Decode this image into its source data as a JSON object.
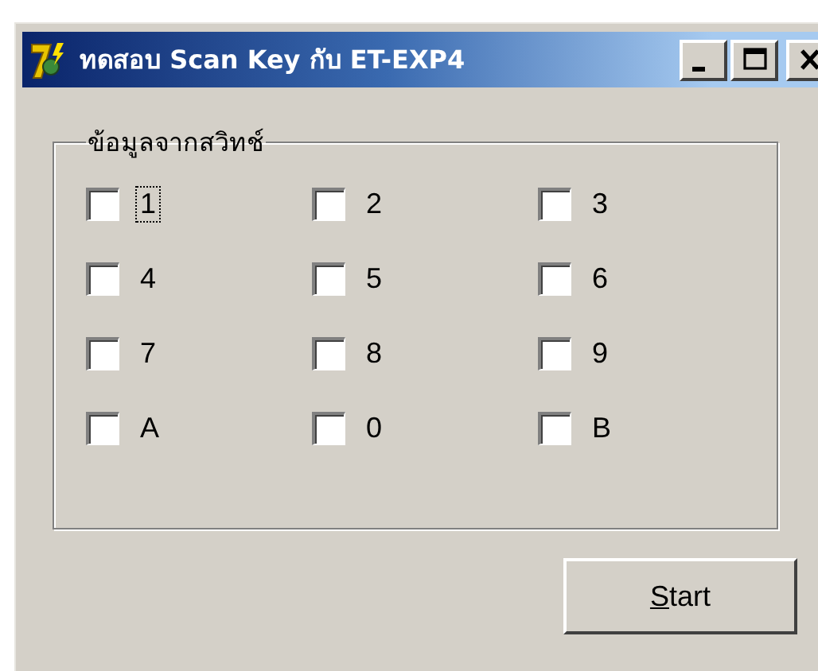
{
  "window": {
    "title": "ทดสอบ Scan Key กับ ET-EXP4",
    "controls": [
      {
        "kind": "minimize"
      },
      {
        "kind": "maximize"
      },
      {
        "kind": "close"
      }
    ]
  },
  "group": {
    "label": "ข้อมูลจากสวิทช์",
    "checkboxes": [
      {
        "label": "1",
        "checked": false,
        "focused": true
      },
      {
        "label": "2",
        "checked": false,
        "focused": false
      },
      {
        "label": "3",
        "checked": false,
        "focused": false
      },
      {
        "label": "4",
        "checked": false,
        "focused": false
      },
      {
        "label": "5",
        "checked": false,
        "focused": false
      },
      {
        "label": "6",
        "checked": false,
        "focused": false
      },
      {
        "label": "7",
        "checked": false,
        "focused": false
      },
      {
        "label": "8",
        "checked": false,
        "focused": false
      },
      {
        "label": "9",
        "checked": false,
        "focused": false
      },
      {
        "label": "A",
        "checked": false,
        "focused": false
      },
      {
        "label": "0",
        "checked": false,
        "focused": false
      },
      {
        "label": "B",
        "checked": false,
        "focused": false
      }
    ]
  },
  "buttons": [
    {
      "label": "Start",
      "underline_first": true
    }
  ]
}
